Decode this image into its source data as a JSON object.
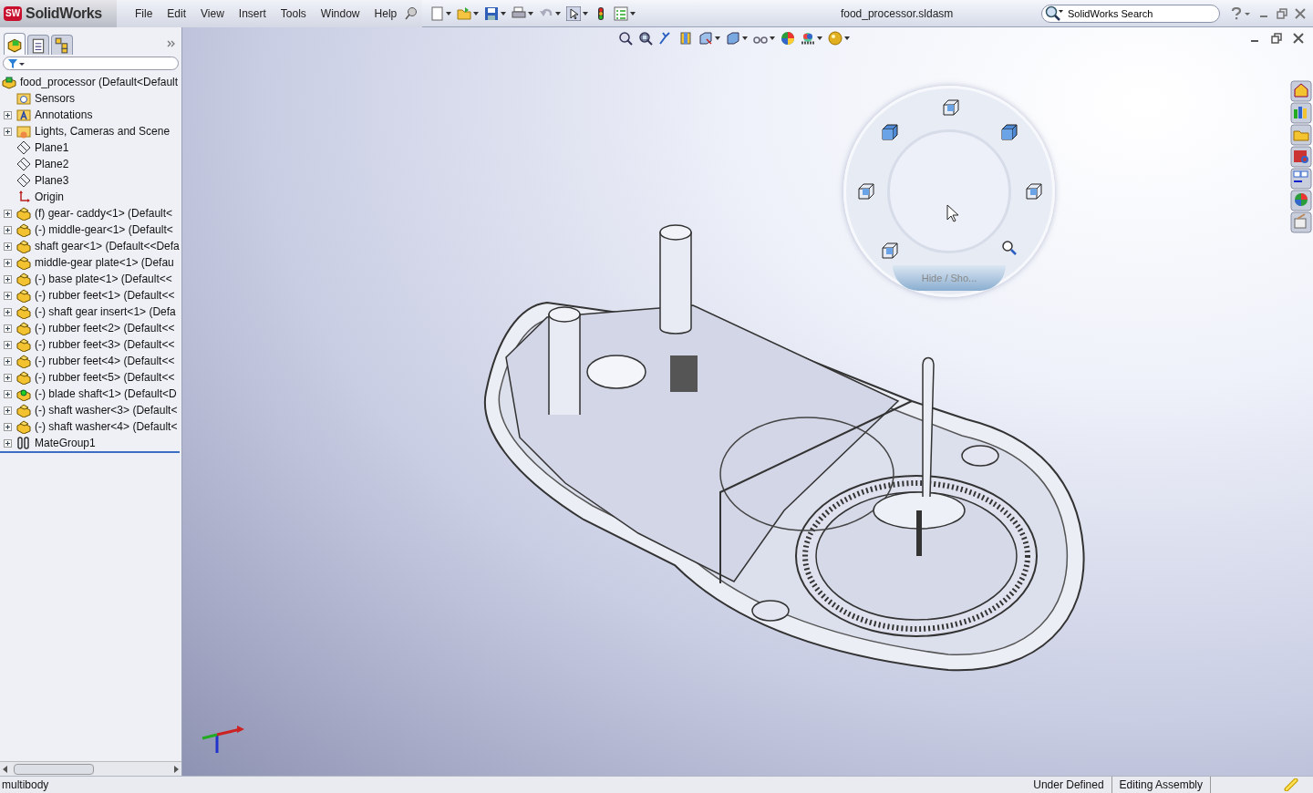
{
  "app": {
    "logo_badge": "SW",
    "logo_text": "SolidWorks"
  },
  "menu": [
    "File",
    "Edit",
    "View",
    "Insert",
    "Tools",
    "Window",
    "Help"
  ],
  "window": {
    "title": "food_processor.sldasm"
  },
  "search": {
    "placeholder": "SolidWorks Search"
  },
  "panel_tabs": [
    {
      "selected": true
    },
    {
      "selected": false
    },
    {
      "selected": false
    }
  ],
  "tree": [
    {
      "kind": "assembly",
      "label": "food_processor  (Default<Default",
      "children": [
        {
          "kind": "sensors",
          "label": "Sensors",
          "expandable": false
        },
        {
          "kind": "annotations",
          "label": "Annotations",
          "expandable": true
        },
        {
          "kind": "lights",
          "label": "Lights, Cameras and Scene",
          "expandable": true
        },
        {
          "kind": "plane",
          "label": "Plane1",
          "expandable": false
        },
        {
          "kind": "plane",
          "label": "Plane2",
          "expandable": false
        },
        {
          "kind": "plane",
          "label": "Plane3",
          "expandable": false
        },
        {
          "kind": "origin",
          "label": "Origin",
          "expandable": false
        },
        {
          "kind": "part",
          "label": "(f) gear- caddy<1> (Default<",
          "expandable": true
        },
        {
          "kind": "part",
          "label": "(-) middle-gear<1> (Default<",
          "expandable": true
        },
        {
          "kind": "part",
          "label": "shaft gear<1> (Default<<Defa",
          "expandable": true
        },
        {
          "kind": "part",
          "label": "middle-gear plate<1> (Defau",
          "expandable": true
        },
        {
          "kind": "part",
          "label": "(-) base plate<1> (Default<<",
          "expandable": true
        },
        {
          "kind": "part",
          "label": "(-) rubber feet<1> (Default<<",
          "expandable": true
        },
        {
          "kind": "part",
          "label": "(-) shaft gear insert<1> (Defa",
          "expandable": true
        },
        {
          "kind": "part",
          "label": "(-) rubber feet<2> (Default<<",
          "expandable": true
        },
        {
          "kind": "part",
          "label": "(-) rubber feet<3> (Default<<",
          "expandable": true
        },
        {
          "kind": "part",
          "label": "(-) rubber feet<4> (Default<<",
          "expandable": true
        },
        {
          "kind": "part",
          "label": "(-) rubber feet<5> (Default<<",
          "expandable": true
        },
        {
          "kind": "part-green",
          "label": "(-) blade shaft<1> (Default<D",
          "expandable": true
        },
        {
          "kind": "part",
          "label": "(-) shaft washer<3> (Default<",
          "expandable": true
        },
        {
          "kind": "part",
          "label": "(-) shaft washer<4> (Default<",
          "expandable": true
        },
        {
          "kind": "mates",
          "label": "MateGroup1",
          "expandable": true
        }
      ]
    }
  ],
  "view_selector": {
    "label": "Hide / Sho..."
  },
  "status_bar": {
    "left": "multibody",
    "state": "Under Defined",
    "mode": "Editing Assembly"
  }
}
